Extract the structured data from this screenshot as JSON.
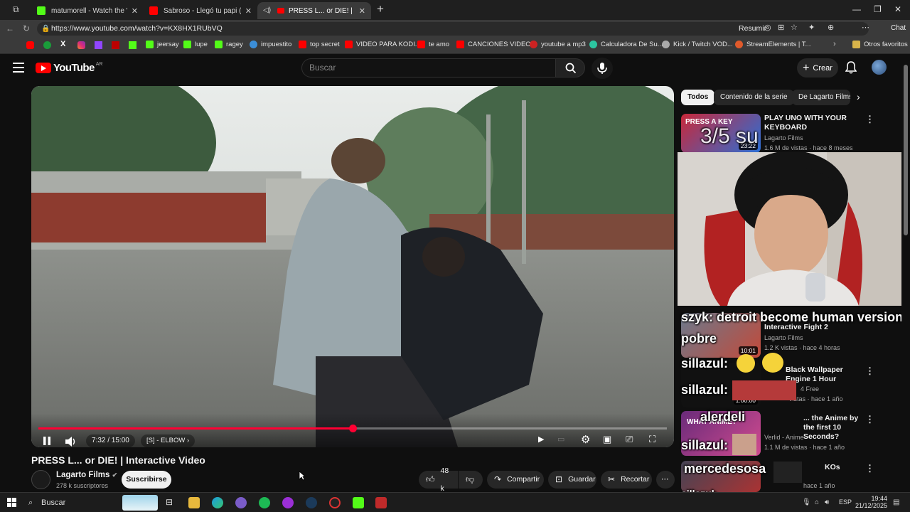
{
  "browser": {
    "tabs": [
      {
        "label": "matumorell - Watch the VOD on K"
      },
      {
        "label": "Sabroso - Llegó tu papi (Videoclip"
      },
      {
        "label": "PRESS L... or DIE! | Interactive"
      }
    ],
    "new_tab_label": "+",
    "url": "https://www.youtube.com/watch?v=KX8HX1RUbVQ",
    "summarize_label": "Resumir",
    "copilot_label": "Chat",
    "bookmarks": [
      {
        "label": "jeersay",
        "color": "#53fc18"
      },
      {
        "label": "lupe",
        "color": "#53fc18"
      },
      {
        "label": "ragey",
        "color": "#53fc18"
      },
      {
        "label": "impuestito",
        "color": "#3b8ed8"
      },
      {
        "label": "top secret",
        "color": "#ff0000"
      },
      {
        "label": "VIDEO PARA KODI...",
        "color": "#ff0000"
      },
      {
        "label": "te amo",
        "color": "#ff0000"
      },
      {
        "label": "CANCIONES VIDEOS",
        "color": "#ff0000"
      },
      {
        "label": "youtube a mp3",
        "color": "#cc2222"
      },
      {
        "label": "Calculadora De Su...",
        "color": "#2cc5a0"
      },
      {
        "label": "Kick / Twitch VOD...",
        "color": "#aaaaaa"
      },
      {
        "label": "StreamElements | T...",
        "color": "#e05a2b"
      }
    ],
    "other_favorites_label": "Otros favoritos"
  },
  "youtube": {
    "logo_text": "YouTube",
    "country_code": "AR",
    "search_placeholder": "Buscar",
    "create_label": "Crear"
  },
  "video": {
    "current_time": "7:32",
    "duration": "15:00",
    "time_display": "7:32 / 15:00",
    "chapter": "[S] - ELBOW",
    "progress": 0.5,
    "title": "PRESS L... or DIE! | Interactive Video",
    "channel_name": "Lagarto Films",
    "channel_subs": "278 k suscriptores",
    "subscribe_label": "Suscribirse",
    "likes": "48 k",
    "share_label": "Compartir",
    "save_label": "Guardar",
    "clip_label": "Recortar"
  },
  "sidebar": {
    "chips": [
      {
        "label": "Todos"
      },
      {
        "label": "Contenido de la serie"
      },
      {
        "label": "De Lagarto Films"
      }
    ],
    "videos": [
      {
        "title": "PLAY UNO WITH YOUR KEYBOARD",
        "channel": "Lagarto Films",
        "meta": "1.6 M de vistas · hace 8 meses",
        "duration": "23:22"
      },
      {
        "title": "Interactive Fight 2",
        "channel": "Lagarto Films",
        "meta": "1.2 K vistas · hace 4 horas",
        "duration": "10:01"
      },
      {
        "title": "Black Wallpaper Engine 1 Hour",
        "channel": "4 Free",
        "meta": "vistas · hace 1 año",
        "duration": "1:00:00"
      },
      {
        "title": "... the Anime by the first 10 Seconds?",
        "channel": "Verlid - Anime",
        "meta": "1.1 M de vistas · hace 1 año",
        "duration": ""
      },
      {
        "title": "KOs",
        "channel": "",
        "meta": "hace 1 año",
        "duration": ""
      }
    ]
  },
  "stream_chat": [
    {
      "text": "3/5 su",
      "color": "#ffffff"
    },
    {
      "text": "szyk: detroit become human version",
      "color": "#ffffff"
    },
    {
      "text": "pobre",
      "color": "#ffffff"
    },
    {
      "text": "sillazul:",
      "color": "#ffffff"
    },
    {
      "text": "sillazul:",
      "color": "#ffffff"
    },
    {
      "text": "alerdeli",
      "color": "#ffffff"
    },
    {
      "text": "sillazul:",
      "color": "#ffffff"
    },
    {
      "text": "mercedesosa",
      "color": "#ffffff"
    },
    {
      "text": "sillazul:",
      "color": "#ffffff"
    }
  ],
  "taskbar": {
    "search_label": "Buscar",
    "language": "ESP",
    "time": "19:44",
    "date": "21/12/2025"
  }
}
